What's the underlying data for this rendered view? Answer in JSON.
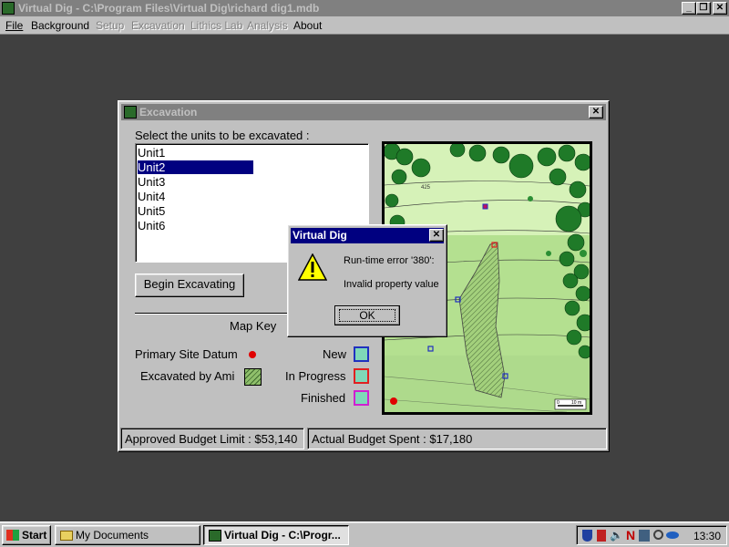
{
  "app": {
    "title": "Virtual Dig - C:\\Program Files\\Virtual Dig\\richard dig1.mdb",
    "menu": [
      "File",
      "Background",
      "Setup",
      "Excavation",
      "Lithics Lab",
      "Analysis",
      "About"
    ]
  },
  "excavation": {
    "title": "Excavation",
    "prompt": "Select the units to be excavated :",
    "units": [
      "Unit1",
      "Unit2",
      "Unit3",
      "Unit4",
      "Unit5",
      "Unit6"
    ],
    "selected_unit": "Unit2",
    "begin_button": "Begin Excavating",
    "map_key": {
      "title": "Map Key",
      "primary_datum": "Primary Site Datum",
      "excavated_by": "Excavated by Ami",
      "new": "New",
      "in_progress": "In Progress",
      "finished": "Finished"
    },
    "map": {
      "contour_label": "425",
      "scale_left": "0",
      "scale_right": "10 m"
    },
    "status": {
      "budget_limit": "Approved Budget Limit : $53,140",
      "budget_spent": "Actual Budget Spent : $17,180"
    }
  },
  "dialog": {
    "title": "Virtual Dig",
    "error_line": "Run-time error '380':",
    "message": "Invalid property value",
    "ok": "OK"
  },
  "taskbar": {
    "start": "Start",
    "tasks": [
      "My Documents",
      "Virtual Dig - C:\\Progr..."
    ],
    "clock": "13:30"
  },
  "colors": {
    "title_active": "#000080",
    "title_inactive": "#808080",
    "desktop": "#404040",
    "datum_red": "#e00000",
    "new_blue": "#2030c0",
    "in_progress_red": "#e02020",
    "finished_magenta": "#d020d0"
  }
}
